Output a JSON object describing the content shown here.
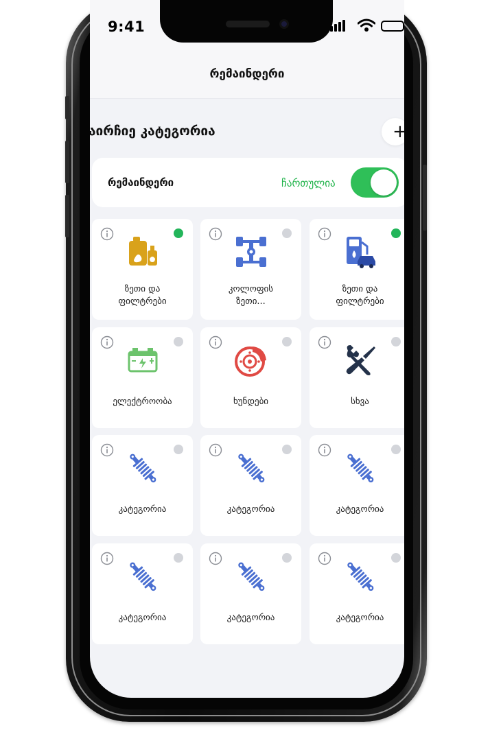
{
  "status_bar": {
    "time": "9:41"
  },
  "header": {
    "title": "რემაინდერი"
  },
  "section": {
    "title": "აირჩიე კატეგორია",
    "add_symbol": "+"
  },
  "reminder": {
    "label": "რემაინდერი",
    "status": "ჩართულია",
    "enabled": true
  },
  "categories": [
    {
      "line1": "ზეთი და",
      "line2": "ფილტრები",
      "icon": "oil-canister-icon",
      "active": true
    },
    {
      "line1": "კოლოფის",
      "line2": "ზეთი...",
      "icon": "gearbox-icon",
      "active": false
    },
    {
      "line1": "ზეთი და",
      "line2": "ფილტრები",
      "icon": "fuel-station-icon",
      "active": true
    },
    {
      "line1": "ელექტროობა",
      "line2": "",
      "icon": "car-battery-icon",
      "active": false
    },
    {
      "line1": "ხუნდები",
      "line2": "",
      "icon": "brake-disc-icon",
      "active": false
    },
    {
      "line1": "სხვა",
      "line2": "",
      "icon": "tools-icon",
      "active": false
    },
    {
      "line1": "კატეგორია",
      "line2": "",
      "icon": "shock-absorber-icon",
      "active": false
    },
    {
      "line1": "კატეგორია",
      "line2": "",
      "icon": "shock-absorber-icon",
      "active": false
    },
    {
      "line1": "კატეგორია",
      "line2": "",
      "icon": "shock-absorber-icon",
      "active": false
    },
    {
      "line1": "კატეგორია",
      "line2": "",
      "icon": "shock-absorber-icon",
      "active": false
    },
    {
      "line1": "კატეგორია",
      "line2": "",
      "icon": "shock-absorber-icon",
      "active": false
    },
    {
      "line1": "კატეგორია",
      "line2": "",
      "icon": "shock-absorber-icon",
      "active": false
    }
  ],
  "colors": {
    "accent_green": "#2fbf58",
    "status_text_green": "#20b34a",
    "inactive_dot": "#d3d5da",
    "icon_blue": "#4a6fd1",
    "brake_red": "#e04a44",
    "oil_gold": "#d9a21b",
    "battery_green": "#6cc36c",
    "tools_dark": "#24324a"
  }
}
